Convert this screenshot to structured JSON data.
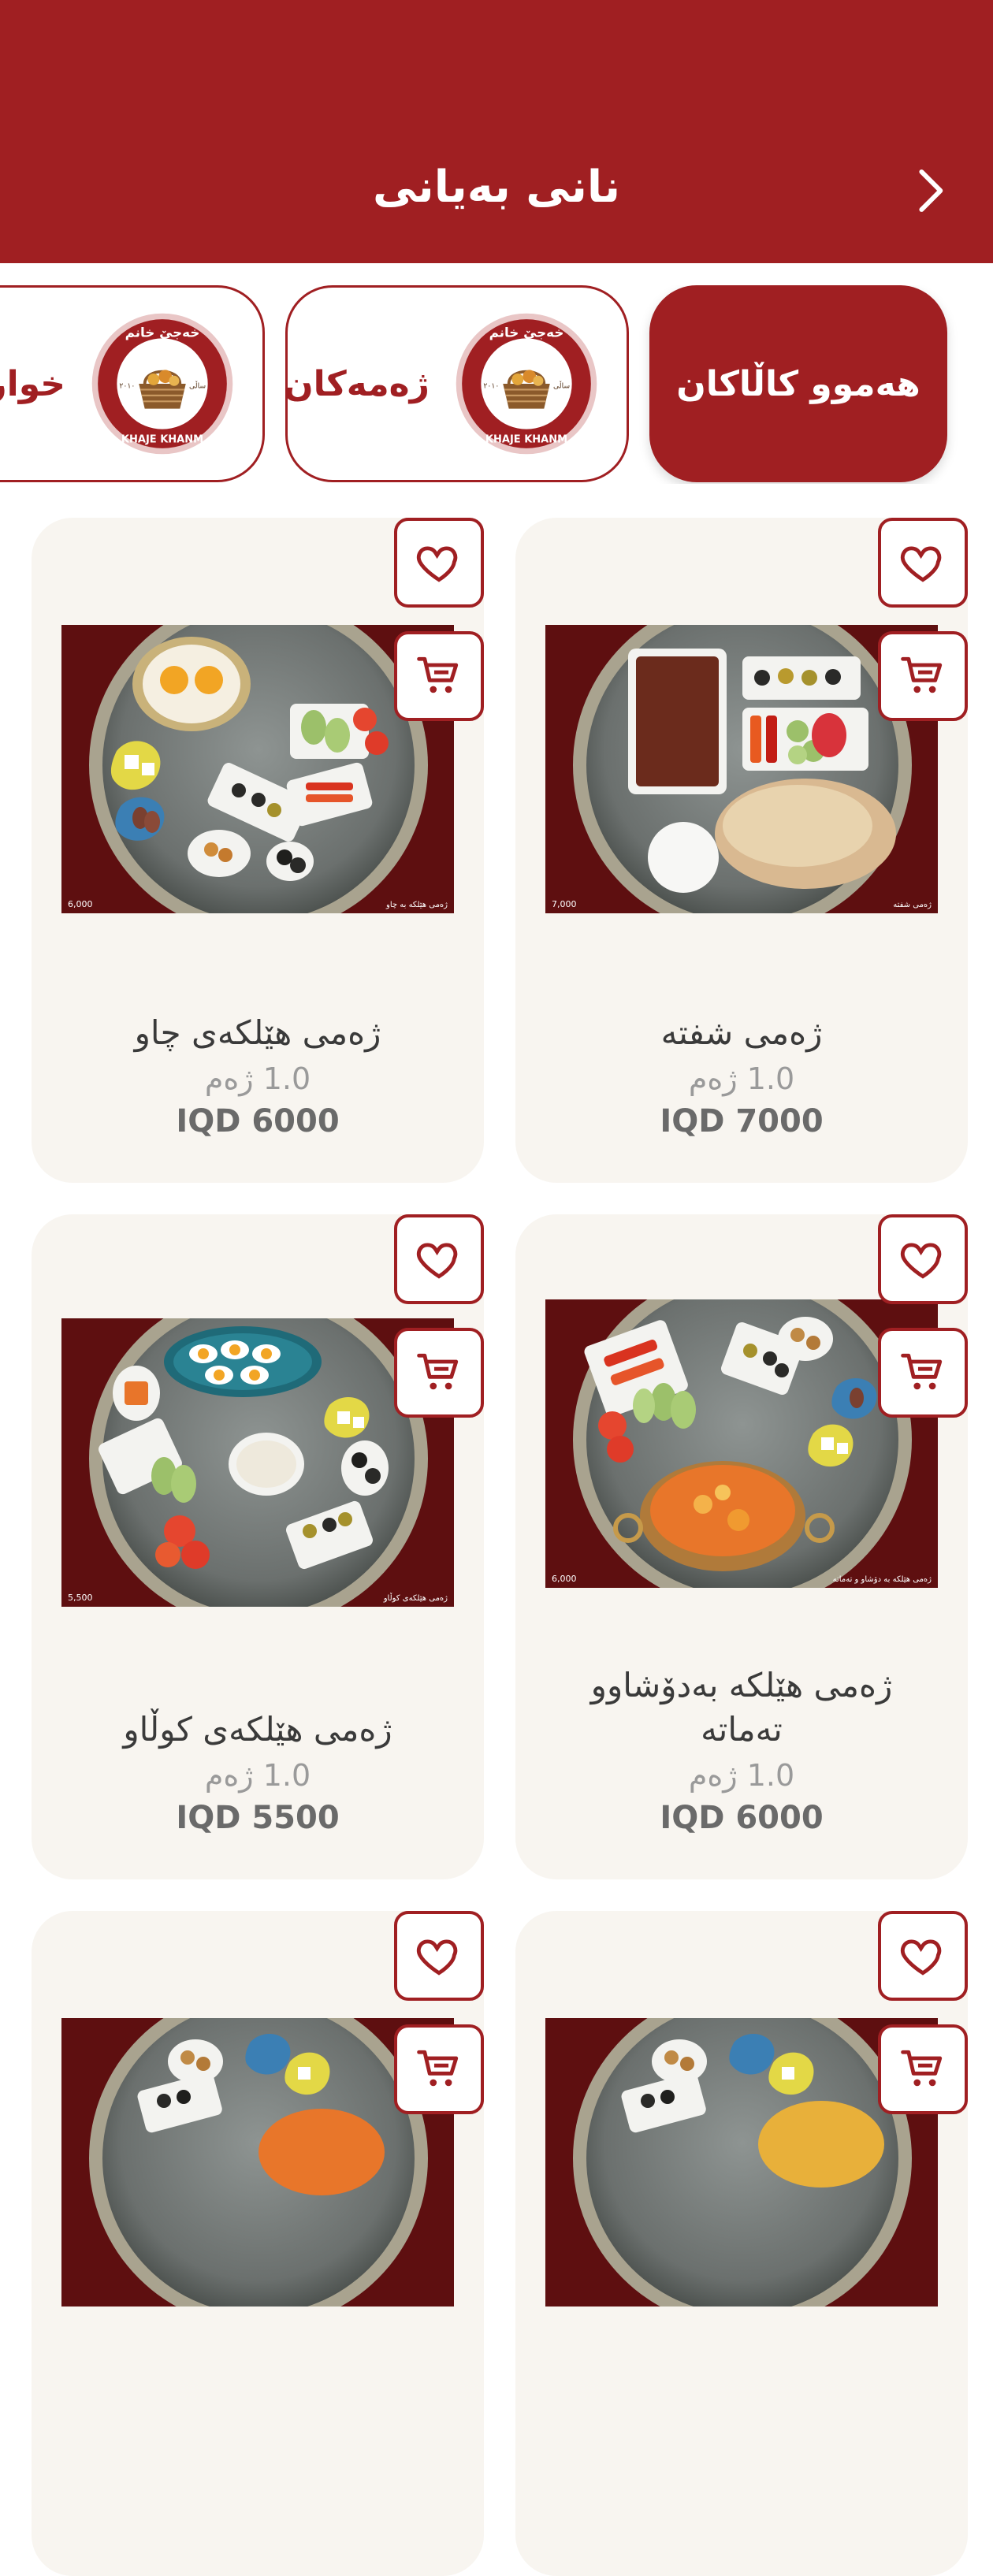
{
  "header": {
    "title": "نانی بەیانی"
  },
  "categories": [
    {
      "label": "هەموو کاڵاکان",
      "active": true
    },
    {
      "label": "ژەمەکان",
      "active": false
    },
    {
      "label": "خواردنەوەکان",
      "active": false
    }
  ],
  "logo": {
    "top_text": "خەجێ خانم",
    "bottom_text": "KHAJE KHANM",
    "left_text": "٢٠١٠",
    "right_text": "ساڵی"
  },
  "products": [
    {
      "name": "ژەمی شفتە",
      "quantity": "1.0 ژەم",
      "price": "IQD 7000",
      "photo_price": "7,000",
      "photo_caption": "ژەمی شفتە"
    },
    {
      "name": "ژەمی هێلکەی چاو",
      "quantity": "1.0 ژەم",
      "price": "IQD 6000",
      "photo_price": "6,000",
      "photo_caption": "ژەمی هێلکە بە چاو"
    },
    {
      "name": "ژەمی هێلکە بەدۆشاوو تەماتە",
      "quantity": "1.0 ژەم",
      "price": "IQD 6000",
      "photo_price": "6,000",
      "photo_caption": "ژەمی هێلکە بە دۆشاو و تەماتە"
    },
    {
      "name": "ژەمی هێلکەی کوڵاو",
      "quantity": "1.0 ژەم",
      "price": "IQD 5500",
      "photo_price": "5,500",
      "photo_caption": "ژەمی هێلکەی کوڵاو"
    },
    {
      "name": "",
      "quantity": "",
      "price": "",
      "photo_price": "",
      "photo_caption": ""
    },
    {
      "name": "",
      "quantity": "",
      "price": "",
      "photo_price": "",
      "photo_caption": ""
    }
  ],
  "colors": {
    "brand": "#a01f22",
    "card_bg": "#f8f5f0",
    "photo_bg": "#5e0f10"
  }
}
